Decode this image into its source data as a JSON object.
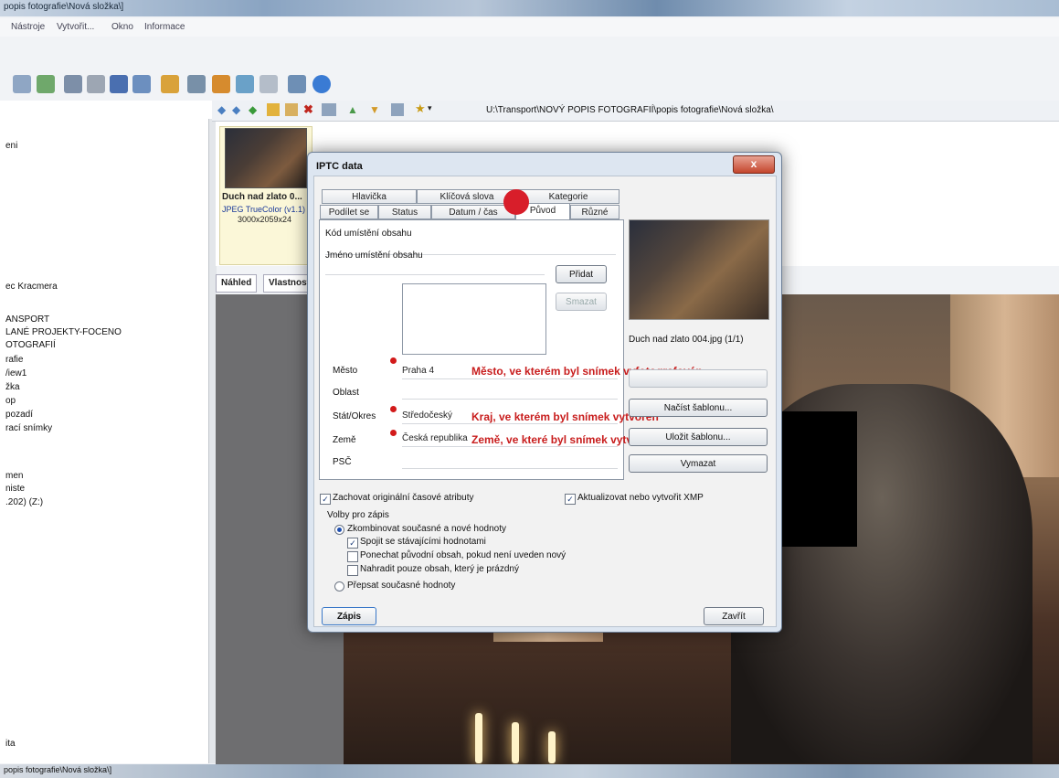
{
  "window": {
    "title": "popis fotografie\\Nová složka\\]",
    "statusbar": "popis fotografie\\Nová složka\\]"
  },
  "menu": [
    "Nástroje",
    "Vytvořit...",
    "Okno",
    "Informace"
  ],
  "address": {
    "path": "U:\\Transport\\NOVÝ POPIS FOTOGRAFIÍ\\popis fotografie\\Nová složka\\"
  },
  "tree": [
    "eni",
    "ec Kracmera",
    "ANSPORT",
    "LANÉ PROJEKTY-FOCENO",
    "OTOGRAFIÍ",
    "rafie",
    "/iew1",
    "žka",
    "op",
    "pozadí",
    "rací snímky",
    "men",
    "niste",
    ".202) (Z:)",
    "ita"
  ],
  "thumbnail": {
    "name": "Duch nad zlato 0...",
    "format": "JPEG TrueColor (v1.1)",
    "size": "3000x2059x24"
  },
  "preview_tabs": [
    "Náhled",
    "Vlastnost"
  ],
  "dialog": {
    "title": "IPTC data",
    "close": "x",
    "tabs_row1": [
      "Hlavička",
      "Klíčová slova",
      "Kategorie"
    ],
    "tabs_row2": [
      "Podílet se",
      "Status",
      "Datum / čas",
      "Původ",
      "Různé"
    ],
    "active_tab": "Původ",
    "fields": {
      "kod_label": "Kód umístění obsahu",
      "jmeno_label": "Jméno umístění obsahu",
      "mesto_label": "Město",
      "mesto_value": "Praha 4",
      "oblast_label": "Oblast",
      "stat_label": "Stát/Okres",
      "stat_value": "Středočeský",
      "zeme_label": "Země",
      "zeme_value": "Česká republika",
      "psc_label": "PSČ"
    },
    "buttons": {
      "pridat": "Přidat",
      "smazat": "Smazat",
      "nacist": "Načíst šablonu...",
      "ulozit": "Uložit šablonu...",
      "vymazat": "Vymazat",
      "zapis": "Zápis",
      "zavrit": "Zavřít"
    },
    "preview_caption": "Duch nad zlato 004.jpg (1/1)",
    "annotations": {
      "mesto": "Město, ve kterém byl snímek vyfotografován",
      "kraj": "Kraj, ve kterém byl snímek vytvořen",
      "zeme": "Země, ve které byl snímek vytvořen"
    },
    "options": {
      "keep_time": "Zachovat originální časové atributy",
      "xmp": "Aktualizovat nebo vytvořit XMP",
      "group": "Volby pro zápis",
      "combine": "Zkombinovat současné a nové hodnoty",
      "join": "Spojit se stávajícími hodnotami",
      "keep_orig": "Ponechat původní obsah, pokud není uveden nový",
      "replace_empty": "Nahradit pouze obsah, který je prázdný",
      "overwrite": "Přepsat současné hodnoty"
    },
    "checked": {
      "keep_time": true,
      "xmp": true,
      "join": true,
      "keep_orig": false,
      "replace_empty": false
    },
    "radio_selected": "combine"
  },
  "colors": {
    "annotation": "#c81d1d",
    "dot": "#d21a1a"
  }
}
